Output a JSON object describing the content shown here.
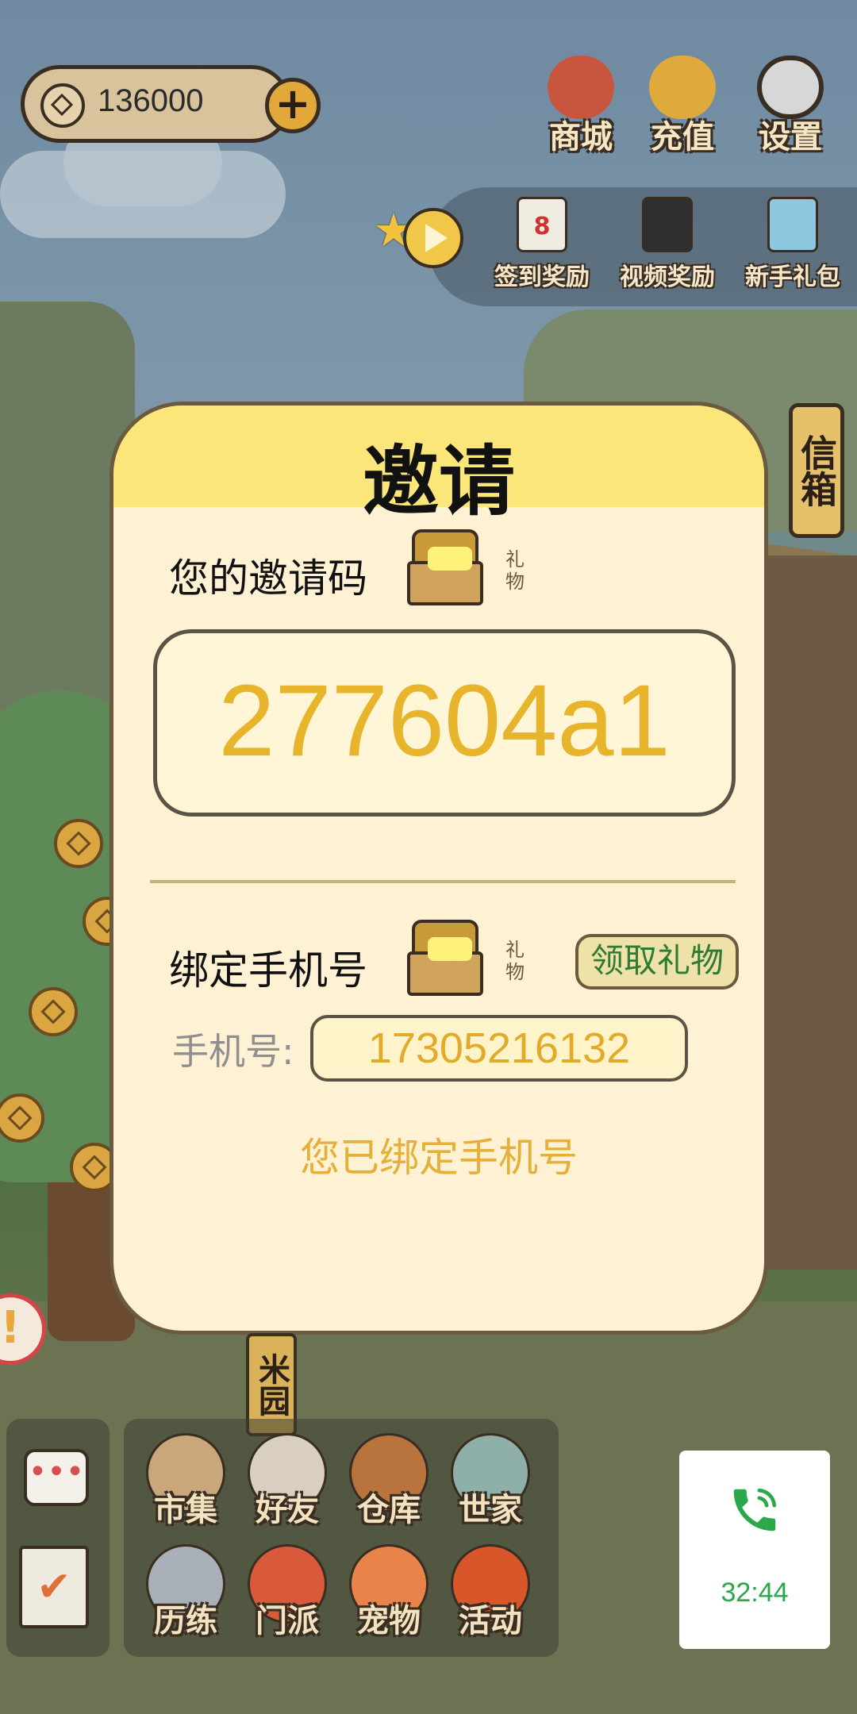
{
  "currency": {
    "amount": "136000",
    "add_symbol": "+"
  },
  "top_menu": [
    {
      "label": "商城",
      "icon": "shop-bag-icon"
    },
    {
      "label": "充值",
      "icon": "gold-ingot-icon"
    },
    {
      "label": "设置",
      "icon": "gear-icon"
    }
  ],
  "rewards": [
    {
      "label": "签到奖励",
      "icon": "calendar-icon",
      "badge": "8"
    },
    {
      "label": "视频奖励",
      "icon": "clapperboard-icon"
    },
    {
      "label": "新手礼包",
      "icon": "chest-icon"
    }
  ],
  "mailbox": {
    "label": "信箱"
  },
  "invite_modal": {
    "title": "邀请",
    "invite_code_label": "您的邀请码",
    "gift_tag": "礼物",
    "invite_code": "277604a1",
    "bind_phone_label": "绑定手机号",
    "claim_button": "领取礼物",
    "phone_label": "手机号:",
    "phone_number": "17305216132",
    "bound_message": "您已绑定手机号"
  },
  "sign": {
    "label": "米园"
  },
  "bottom_menu": [
    {
      "label": "市集",
      "icon": "market-icon"
    },
    {
      "label": "好友",
      "icon": "handshake-icon"
    },
    {
      "label": "仓库",
      "icon": "warehouse-chest-icon"
    },
    {
      "label": "世家",
      "icon": "family-jar-icon"
    },
    {
      "label": "历练",
      "icon": "crossed-swords-icon"
    },
    {
      "label": "门派",
      "icon": "sect-banner-icon"
    },
    {
      "label": "宠物",
      "icon": "paw-icon"
    },
    {
      "label": "活动",
      "icon": "lantern-icon"
    }
  ],
  "call_widget": {
    "time": "32:44"
  },
  "colors": {
    "modal_bg": "#fff1d4",
    "modal_header": "#fbe67a",
    "accent_gold": "#e8b42c",
    "claim_green": "#2f7a34",
    "call_green": "#2aa84a"
  }
}
